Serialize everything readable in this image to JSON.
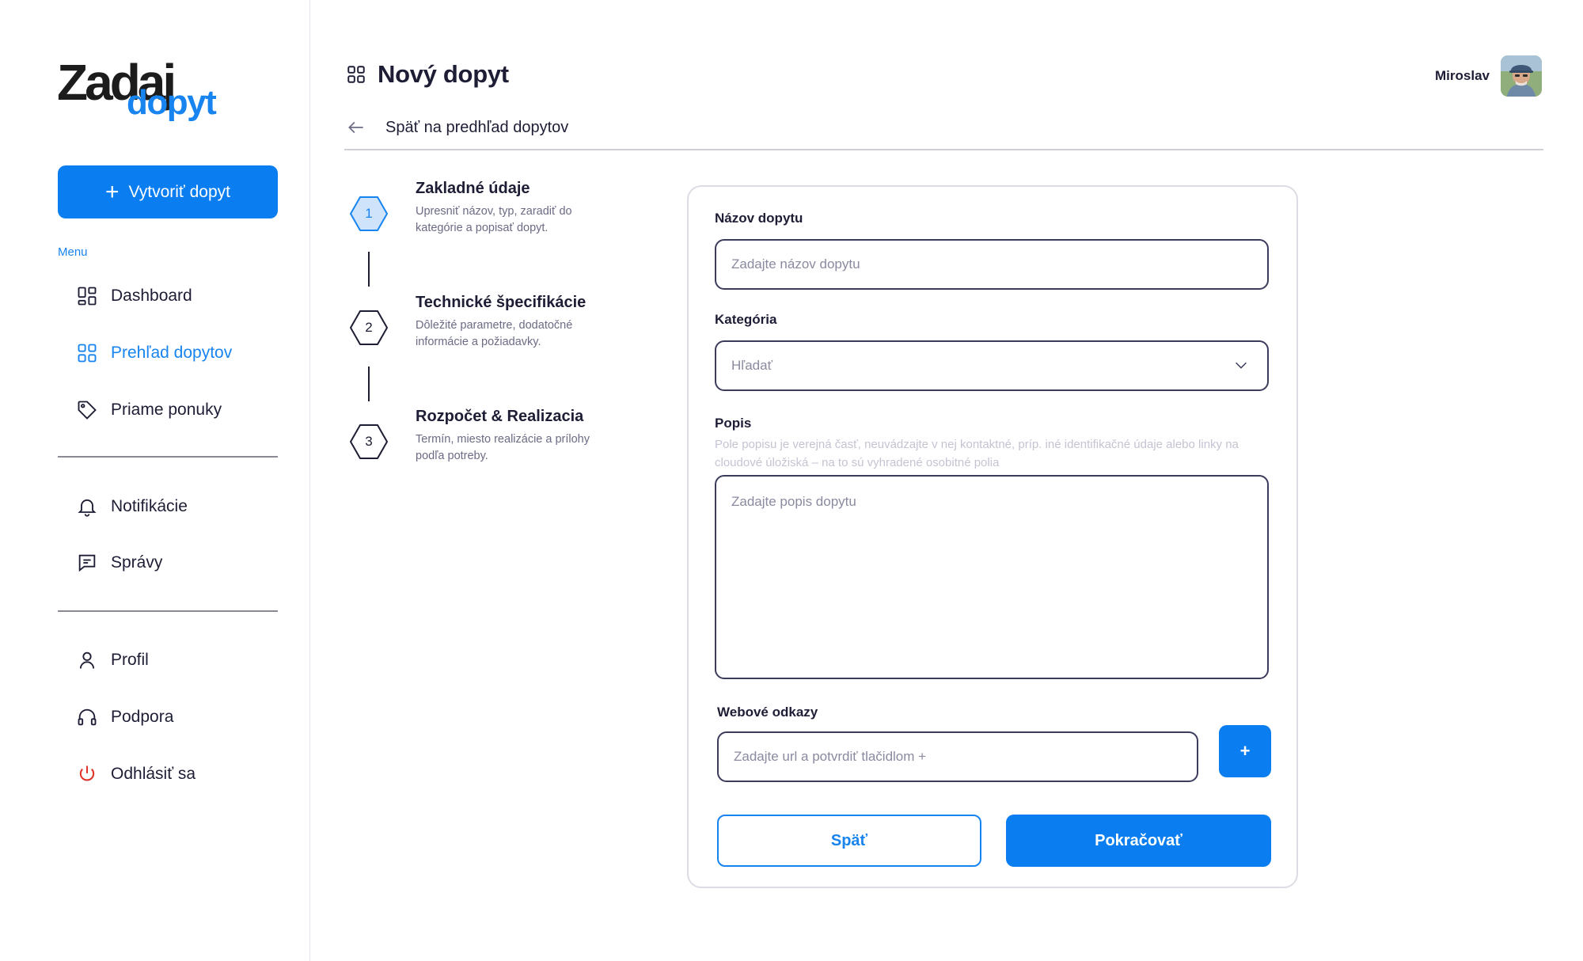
{
  "logo": {
    "line1": "Zadaj",
    "line2": "dopyt"
  },
  "sidebar": {
    "create_button_label": "Vytvoriť dopyt",
    "menu_caption": "Menu",
    "items": [
      {
        "label": "Dashboard",
        "icon": "dashboard-icon"
      },
      {
        "label": "Prehľad dopytov",
        "icon": "grid-icon",
        "active": true
      },
      {
        "label": "Priame ponuky",
        "icon": "tag-icon"
      },
      {
        "label": "Notifikácie",
        "icon": "bell-icon"
      },
      {
        "label": "Správy",
        "icon": "message-icon"
      },
      {
        "label": "Profil",
        "icon": "user-icon"
      },
      {
        "label": "Podpora",
        "icon": "headset-icon"
      },
      {
        "label": "Odhlásiť sa",
        "icon": "power-icon"
      }
    ]
  },
  "header": {
    "title": "Nový dopyt",
    "back_link": "Späť na predhľad dopytov",
    "user_name": "Miroslav"
  },
  "steps": [
    {
      "number": "1",
      "title": "Zakladné údaje",
      "description": "Upresniť názov, typ, zaradiť do kategórie a popisať dopyt.",
      "current": true
    },
    {
      "number": "2",
      "title": "Technické špecifikácie",
      "description": "Dôležité parametre, dodatočné informácie a požiadavky."
    },
    {
      "number": "3",
      "title": "Rozpočet & Realizacia",
      "description": "Termín, miesto realizácie a prílohy podľa potreby."
    }
  ],
  "form": {
    "name": {
      "label": "Názov dopytu",
      "placeholder": "Zadajte názov dopytu"
    },
    "category": {
      "label": "Kategória",
      "placeholder": "Hľadať"
    },
    "description": {
      "label": "Popis",
      "hint": "Pole popisu je verejná časť, neuvádzajte v nej kontaktné, príp. iné identifikačné údaje alebo linky na cloudové úložiská – na to sú vyhradené osobitné polia",
      "placeholder": "Zadajte popis dopytu"
    },
    "links": {
      "label": "Webové odkazy",
      "placeholder": "Zadajte url a potvrdiť tlačidlom +",
      "add_label": "+"
    },
    "back_button": "Späť",
    "continue_button": "Pokračovať"
  },
  "colors": {
    "accent": "#0a7ef0",
    "text": "#1d1d35",
    "logout": "#e0352b"
  }
}
